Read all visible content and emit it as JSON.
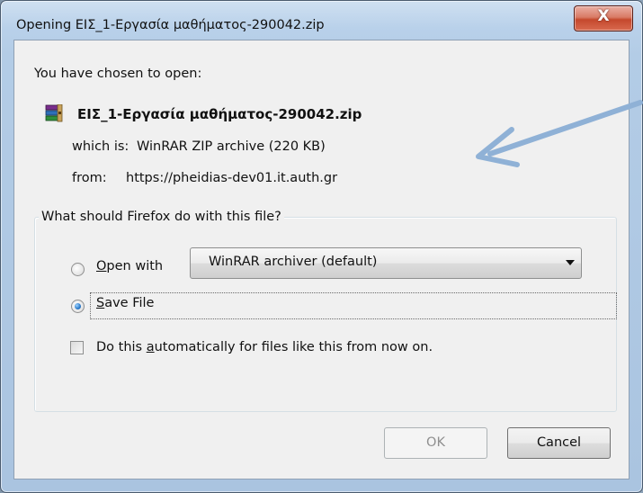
{
  "window": {
    "title": "Opening ΕΙΣ_1-Εργασία μαθήματος-290042.zip",
    "close_glyph": "X"
  },
  "info": {
    "chosen_label": "You have chosen to open:",
    "filename": "ΕΙΣ_1-Εργασία μαθήματος-290042.zip",
    "file_icon": "winrar-archive-icon",
    "which_is_label": "which is:",
    "which_is_value": "WinRAR ZIP archive (220 KB)",
    "from_label": "from:",
    "from_value": "https://pheidias-dev01.it.auth.gr"
  },
  "action_group": {
    "legend": "What should Firefox do with this file?",
    "open_with": {
      "label_first": "O",
      "label_rest": "pen with",
      "checked": false
    },
    "application_select": {
      "value": "WinRAR archiver (default)"
    },
    "save_file": {
      "label_first": "S",
      "label_rest": "ave File",
      "checked": true
    },
    "auto_checkbox": {
      "label_before": "Do this ",
      "label_underlined": "a",
      "label_after": "utomatically for files like this from now on.",
      "checked": false
    }
  },
  "buttons": {
    "ok_label": "OK",
    "ok_disabled": true,
    "cancel_label": "Cancel"
  },
  "annotation": {
    "arrow_color": "#8fb1d6"
  }
}
